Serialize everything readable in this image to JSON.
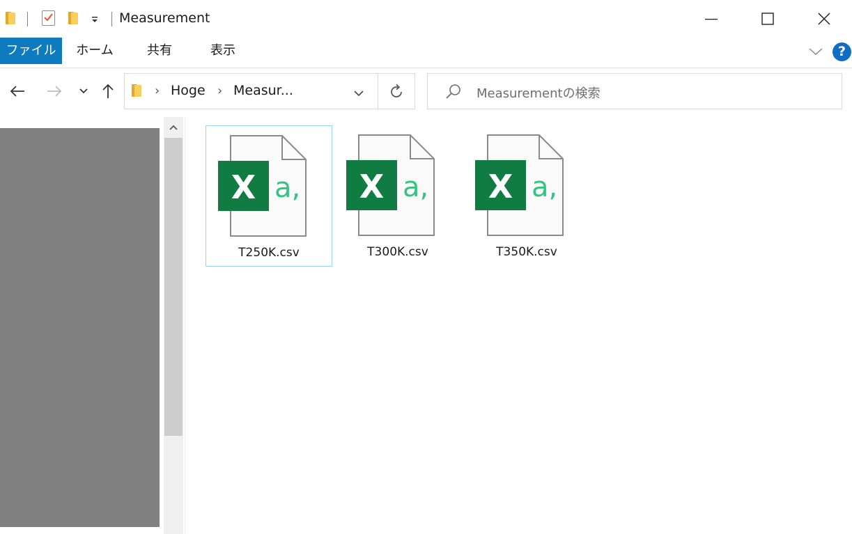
{
  "window": {
    "title": "Measurement"
  },
  "ribbon": {
    "tabs": [
      "ファイル",
      "ホーム",
      "共有",
      "表示"
    ]
  },
  "address_bar": {
    "breadcrumbs": [
      "Hoge",
      "Measur..."
    ]
  },
  "search": {
    "placeholder": "Measurementの検索"
  },
  "files": [
    {
      "name": "T250K.csv",
      "icon": "excel-csv-icon",
      "selected": true
    },
    {
      "name": "T300K.csv",
      "icon": "excel-csv-icon",
      "selected": false
    },
    {
      "name": "T350K.csv",
      "icon": "excel-csv-icon",
      "selected": false
    }
  ],
  "icons": {
    "file_glyph_letter": "X",
    "file_glyph_text": "a,"
  },
  "colors": {
    "file_tab": "#0f7bbf",
    "excel_green": "#107c41",
    "csv_text_green": "#33c481",
    "help": "#0f6dc4",
    "selection_border": "#99d1ff",
    "nav_pane": "#808080"
  }
}
